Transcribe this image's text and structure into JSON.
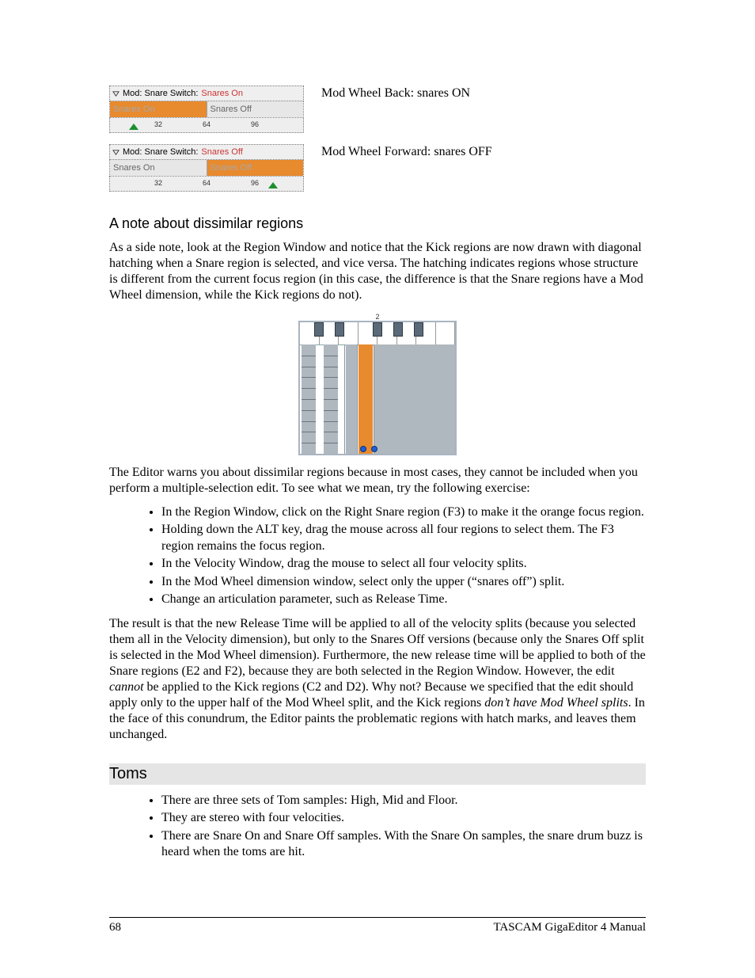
{
  "panels": {
    "title_label": "Mod: Snare Switch:",
    "left_cell": "Snares On",
    "right_cell": "Snares Off",
    "ticks": [
      "32",
      "64",
      "96"
    ],
    "on": {
      "state": "Snares On",
      "caption": "Mod Wheel Back: snares ON"
    },
    "off": {
      "state": "Snares Off",
      "caption": "Mod Wheel Forward: snares OFF"
    }
  },
  "octave_label": "2",
  "sect": {
    "dissimilar_h": "A note about dissimilar regions",
    "p1": "As a side note, look at the Region Window and notice that the Kick regions are now drawn with diagonal hatching when a Snare region is selected, and vice versa.  The hatching indicates regions whose structure is different from the current focus region (in this case, the difference is that the Snare regions have a Mod Wheel dimension, while the Kick regions do not).",
    "p2": "The Editor warns you about dissimilar regions because in most cases, they cannot be included when you perform a multiple-selection edit.  To see what we mean, try the following exercise:",
    "bullets1": [
      "In the Region Window, click on the Right Snare region (F3) to make it the orange focus region.",
      "Holding down the ALT key, drag the mouse across all four regions to select them.  The F3 region remains the focus region.",
      "In the Velocity Window, drag the mouse to select all four velocity splits.",
      "In the Mod Wheel dimension window, select only the upper (“snares off”) split.",
      "Change an articulation parameter, such as Release Time."
    ],
    "p3a": "The result is that the new Release Time will be applied to all of the velocity splits (because you selected them all in the Velocity dimension), but only to the Snares Off versions (because only the Snares Off split is selected in the Mod Wheel dimension).  Furthermore, the new release time will be applied to both of the Snare regions (E2 and F2), because they are both selected in the Region Window.  However, the edit ",
    "p3_em1": "cannot",
    "p3b": " be applied to the Kick regions (C2 and D2).  Why not?  Because we specified that the edit should apply only to the upper half of the Mod Wheel split, and the Kick regions ",
    "p3_em2": "don’t have Mod Wheel splits",
    "p3c": ".  In the face of this conundrum, the Editor paints the problematic regions with hatch marks, and leaves them unchanged.",
    "toms_h": "Toms",
    "bullets2": [
      "There are three sets of Tom samples: High, Mid and Floor.",
      "They are stereo with four velocities.",
      "There are Snare On and Snare Off samples.  With the Snare On samples, the snare drum buzz is heard when the toms are hit."
    ]
  },
  "footer": {
    "page": "68",
    "title": "TASCAM GigaEditor 4 Manual"
  }
}
